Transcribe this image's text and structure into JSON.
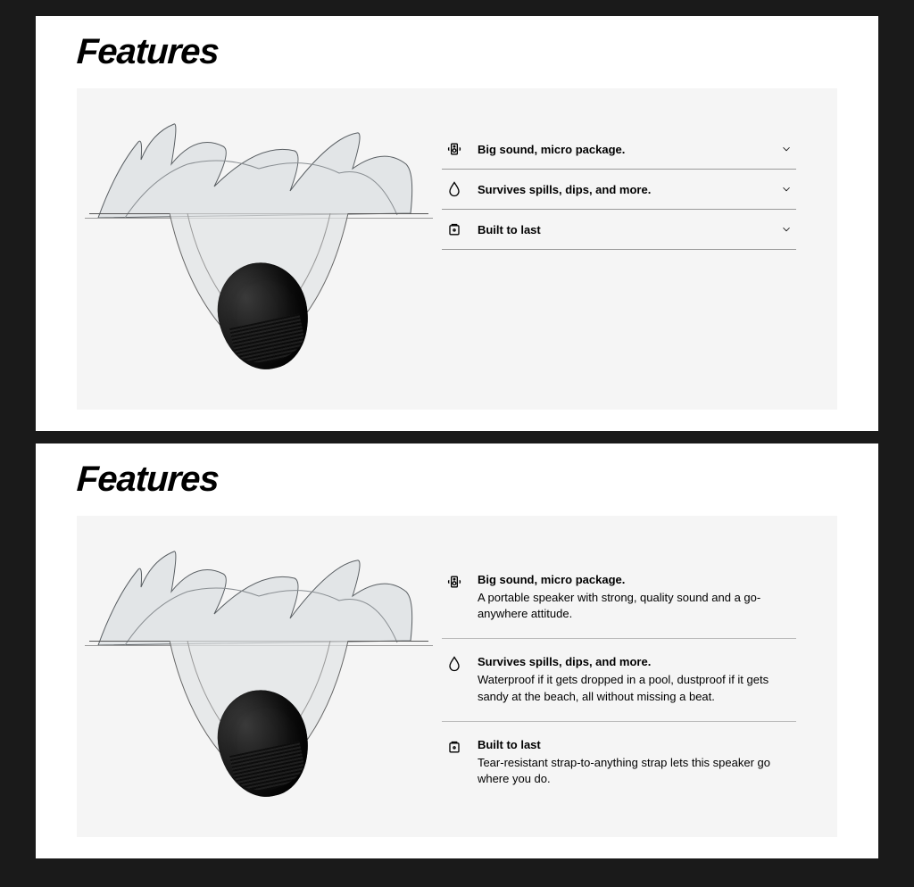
{
  "section_title": "Features",
  "features": [
    {
      "icon": "speaker-icon",
      "title": "Big sound, micro package.",
      "desc": "A portable speaker with strong, quality sound and a go-anywhere attitude."
    },
    {
      "icon": "water-drop-icon",
      "title": "Survives spills, dips, and more.",
      "desc": "Waterproof if it gets dropped in a pool, dustproof if it gets sandy at the beach, all without missing a beat."
    },
    {
      "icon": "durable-icon",
      "title": "Built to last",
      "desc": "Tear-resistant strap-to-anything strap lets this speaker go where you do."
    }
  ]
}
